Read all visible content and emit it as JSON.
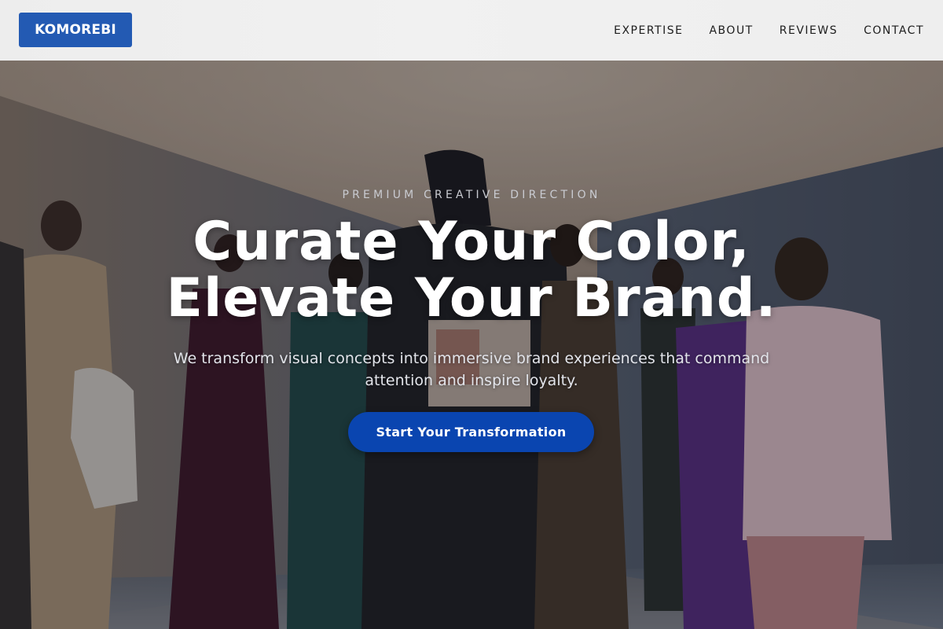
{
  "brand": {
    "logo_text": "KOMOREBI",
    "accent": "#235ab3"
  },
  "nav": {
    "items": [
      {
        "label": "EXPERTISE"
      },
      {
        "label": "ABOUT"
      },
      {
        "label": "REVIEWS"
      },
      {
        "label": "CONTACT"
      }
    ]
  },
  "hero": {
    "eyebrow": "PREMIUM CREATIVE DIRECTION",
    "headline_line1": "Curate Your Color,",
    "headline_line2": "Elevate Your Brand.",
    "subheadline": "We transform visual concepts into immersive brand experiences that command attention and inspire loyalty.",
    "cta_label": "Start Your Transformation",
    "cta_color": "#0a45b0",
    "background_image": "fashion-group-photo"
  }
}
